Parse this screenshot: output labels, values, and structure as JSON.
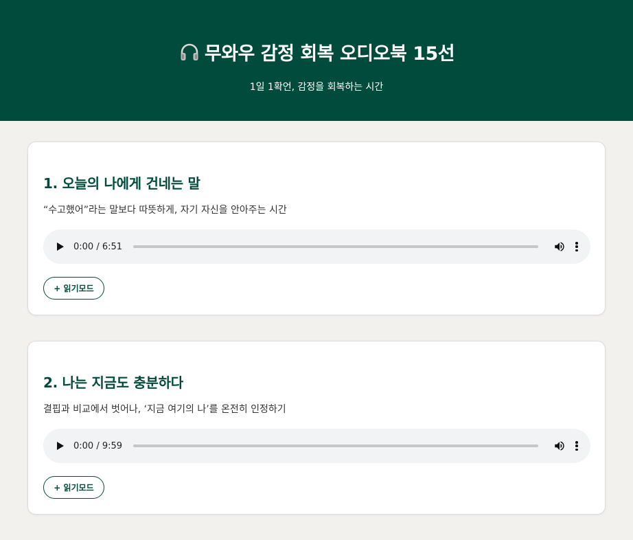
{
  "header": {
    "icon": "headphones-icon",
    "title": "무와우 감정 회복 오디오북 15선",
    "subtitle": "1일 1확언, 감정을 회복하는 시간"
  },
  "colors": {
    "brand": "#004b3c",
    "background": "#f2f1ed",
    "player": "#f1f3f4"
  },
  "cards": [
    {
      "title": "1. 오늘의 나에게 건네는 말",
      "description": "“수고했어”라는 말보다 따뜻하게, 자기 자신을 안아주는 시간",
      "player": {
        "time": "0:00 / 6:51",
        "progress": 0
      },
      "read_mode_label": "+ 읽기모드"
    },
    {
      "title": "2. 나는 지금도 충분하다",
      "description": "결핍과 비교에서 벗어나, ‘지금 여기의 나’를 온전히 인정하기",
      "player": {
        "time": "0:00 / 9:59",
        "progress": 0
      },
      "read_mode_label": "+ 읽기모드"
    }
  ]
}
